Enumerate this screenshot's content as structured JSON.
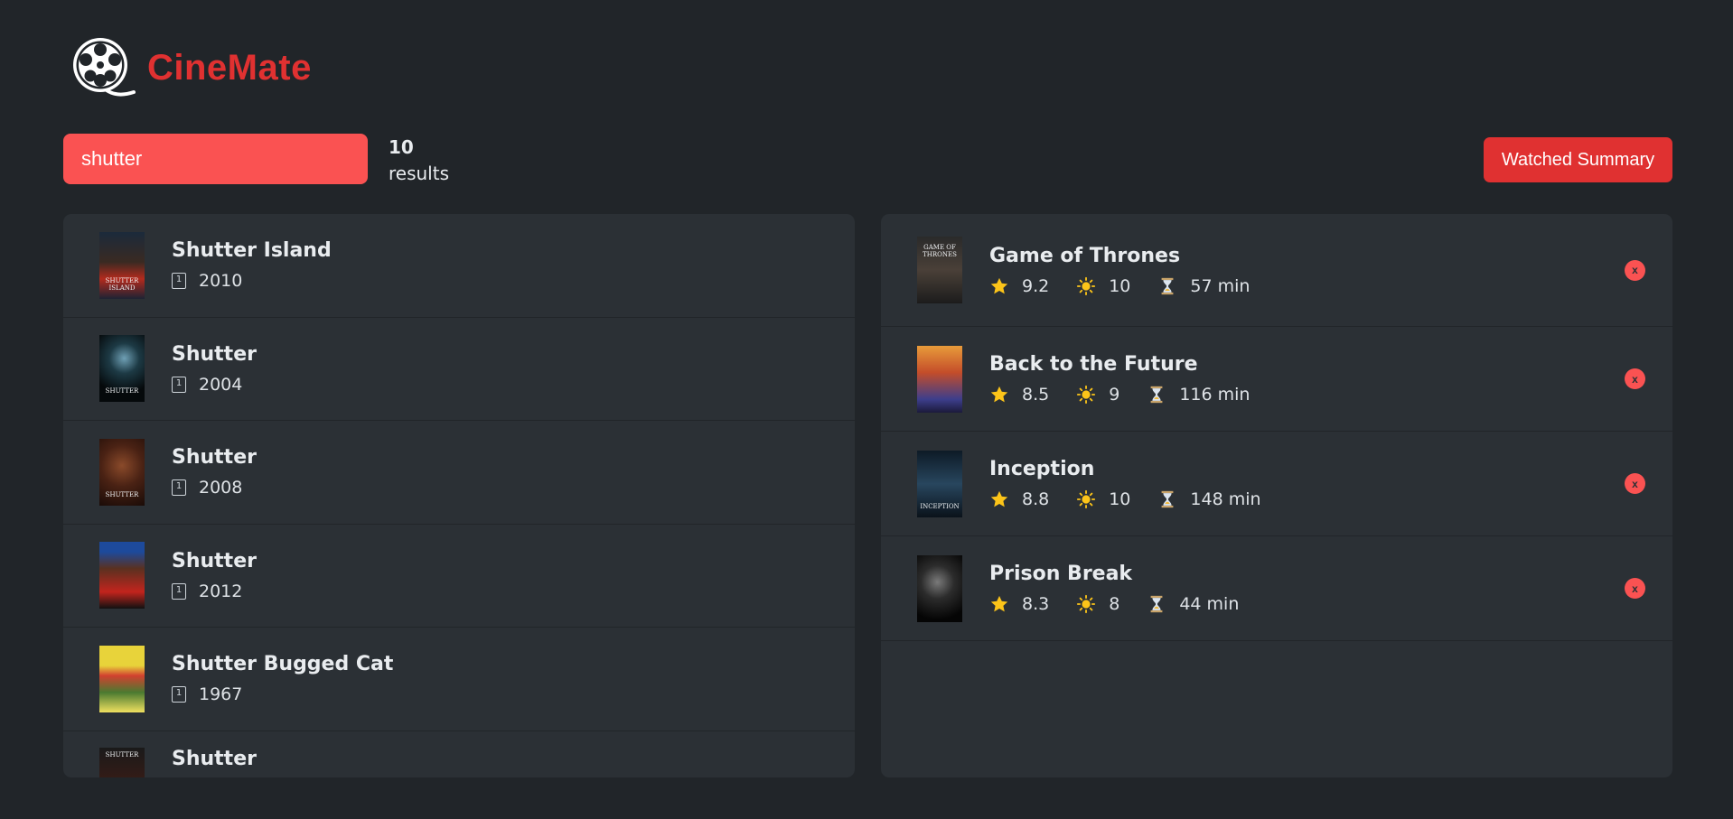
{
  "app": {
    "brand": "CineMate"
  },
  "search": {
    "value": "shutter",
    "placeholder": ""
  },
  "results": {
    "count": "10",
    "label": "results"
  },
  "summary_button": "Watched Summary",
  "search_results": [
    {
      "title": "Shutter Island",
      "year": "2010",
      "poster_text": "SHUTTER ISLAND"
    },
    {
      "title": "Shutter",
      "year": "2004",
      "poster_text": "SHUTTER"
    },
    {
      "title": "Shutter",
      "year": "2008",
      "poster_text": "SHUTTER"
    },
    {
      "title": "Shutter",
      "year": "2012",
      "poster_text": ""
    },
    {
      "title": "Shutter Bugged Cat",
      "year": "1967",
      "poster_text": ""
    },
    {
      "title": "Shutter",
      "year": "",
      "poster_text": "SHUTTER"
    }
  ],
  "watched": [
    {
      "title": "Game of Thrones",
      "imdb": "9.2",
      "user": "10",
      "runtime": "57 min",
      "poster_text": "GAME OF THRONES"
    },
    {
      "title": "Back to the Future",
      "imdb": "8.5",
      "user": "9",
      "runtime": "116 min",
      "poster_text": ""
    },
    {
      "title": "Inception",
      "imdb": "8.8",
      "user": "10",
      "runtime": "148 min",
      "poster_text": "INCEPTION"
    },
    {
      "title": "Prison Break",
      "imdb": "8.3",
      "user": "8",
      "runtime": "44 min",
      "poster_text": ""
    }
  ],
  "delete_label": "x",
  "colors": {
    "accent": "#e03131",
    "search_bg": "#fa5252",
    "background": "#212529",
    "panel": "#2b3035",
    "star": "#fcc419"
  },
  "icons": {
    "logo": "film-reel-icon",
    "year": "calendar-icon",
    "imdb": "star-icon",
    "user_rating": "sun-icon",
    "runtime": "hourglass-icon"
  }
}
